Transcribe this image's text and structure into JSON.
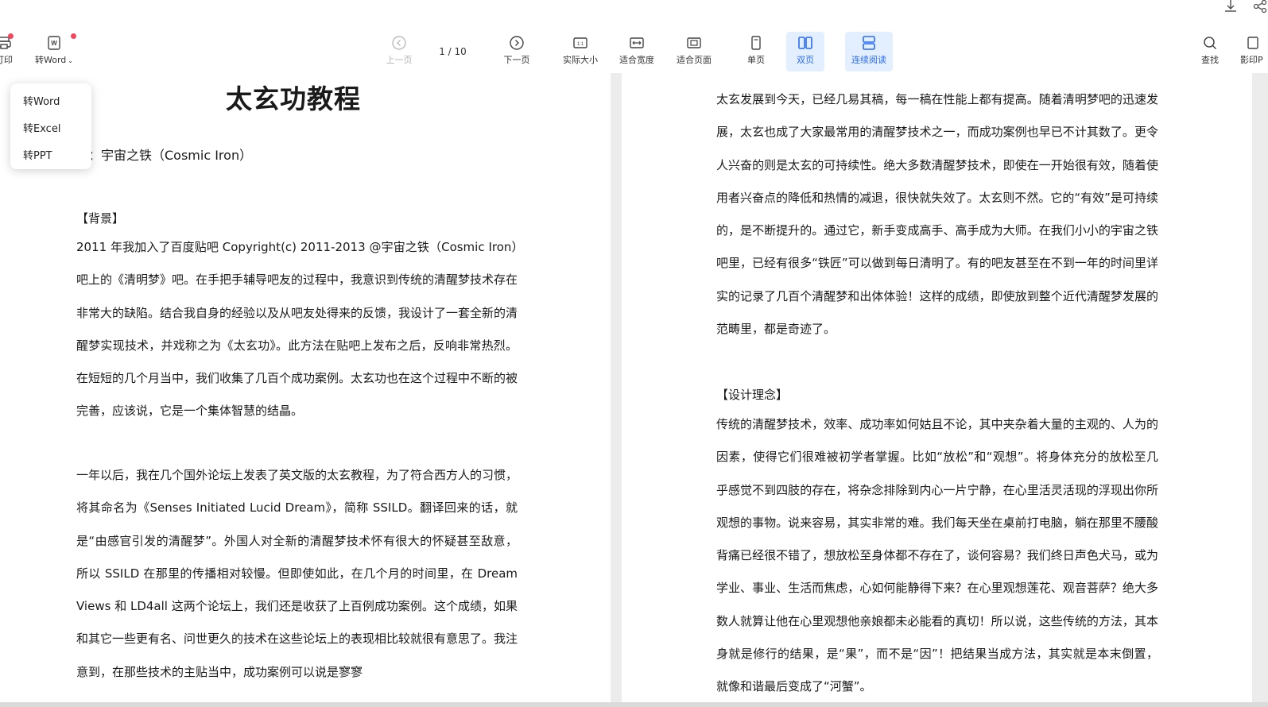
{
  "toolbar": {
    "print_label": "打印",
    "convert_label": "转Word",
    "prev_label": "上一页",
    "page_indicator": "1  / 10",
    "next_label": "下一页",
    "actual_size_label": "实际大小",
    "fit_width_label": "适合宽度",
    "fit_page_label": "适合页面",
    "single_label": "单页",
    "double_label": "双页",
    "continuous_label": "连续阅读",
    "find_label": "查找",
    "shadow_print_label": "影印P"
  },
  "dropdown": {
    "items": [
      "转Word",
      "转Excel",
      "转PPT"
    ]
  },
  "left_page": {
    "title": "太玄功教程",
    "author": "者：宇宙之铁（Cosmic Iron）",
    "section1_heading": "【背景】",
    "para1": "2011 年我加入了百度贴吧 Copyright(c) 2011-2013 @宇宙之铁（Cosmic Iron）吧上的《清明梦》吧。在手把手辅导吧友的过程中，我意识到传统的清醒梦技术存在非常大的缺陷。结合我自身的经验以及从吧友处得来的反馈，我设计了一套全新的清醒梦实现技术，并戏称之为《太玄功》。此方法在贴吧上发布之后，反响非常热烈。在短短的几个月当中，我们收集了几百个成功案例。太玄功也在这个过程中不断的被完善，应该说，它是一个集体智慧的结晶。",
    "para2": "一年以后，我在几个国外论坛上发表了英文版的太玄教程，为了符合西方人的习惯，将其命名为《Senses Initiated Lucid Dream》，简称 SSILD。翻译回来的话，就是“由感官引发的清醒梦”。外国人对全新的清醒梦技术怀有很大的怀疑甚至敌意，所以 SSILD 在那里的传播相对较慢。但即使如此，在几个月的时间里，在 Dream Views 和 LD4all 这两个论坛上，我们还是收获了上百例成功案例。这个成绩，如果和其它一些更有名、问世更久的技术在这些论坛上的表现相比较就很有意思了。我注意到，在那些技术的主贴当中，成功案例可以说是寥寥"
  },
  "right_page": {
    "para1": "太玄发展到今天，已经几易其稿，每一稿在性能上都有提高。随着清明梦吧的迅速发展，太玄也成了大家最常用的清醒梦技术之一，而成功案例也早已不计其数了。更令人兴奋的则是太玄的可持续性。绝大多数清醒梦技术，即使在一开始很有效，随着使用者兴奋点的降低和热情的减退，很快就失效了。太玄则不然。它的“有效”是可持续的，是不断提升的。通过它，新手变成高手、高手成为大师。在我们小小的宇宙之铁吧里，已经有很多“铁匠”可以做到每日清明了。有的吧友甚至在不到一年的时间里详实的记录了几百个清醒梦和出体体验！这样的成绩，即使放到整个近代清醒梦发展的范畴里，都是奇迹了。",
    "section2_heading": "【设计理念】",
    "para2": "传统的清醒梦技术，效率、成功率如何姑且不论，其中夹杂着大量的主观的、人为的因素，使得它们很难被初学者掌握。比如“放松”和“观想”。将身体充分的放松至几乎感觉不到四肢的存在，将杂念排除到内心一片宁静，在心里活灵活现的浮现出你所观想的事物。说来容易，其实非常的难。我们每天坐在桌前打电脑，躺在那里不腰酸背痛已经很不错了，想放松至身体都不存在了，谈何容易？我们终日声色犬马，或为学业、事业、生活而焦虑，心如何能静得下来？在心里观想莲花、观音菩萨？绝大多数人就算让他在心里观想他亲娘都未必能看的真切！所以说，这些传统的方法，其本身就是修行的结果，是“果”，而不是“因”！把结果当成方法，其实就是本末倒置，就像和谐最后变成了“河蟹”。"
  },
  "colors": {
    "accent": "#2a6cf0",
    "active_bg": "#e3efff",
    "badge": "#f5455c"
  }
}
